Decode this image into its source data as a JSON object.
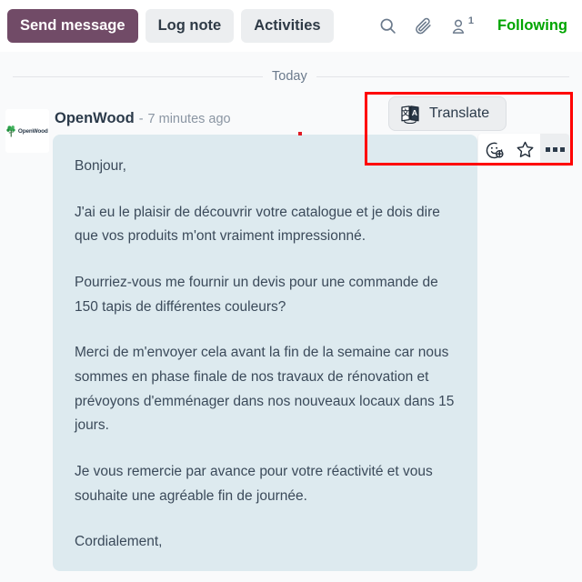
{
  "toolbar": {
    "send_message_label": "Send message",
    "log_note_label": "Log note",
    "activities_label": "Activities",
    "search_icon": "search-icon",
    "attachment_icon": "paperclip-icon",
    "followers_icon": "person-icon",
    "followers_count": "1",
    "following_label": "Following",
    "primary_color": "#714B67",
    "following_color": "#00A500"
  },
  "thread": {
    "date_divider_label": "Today",
    "message": {
      "author": "OpenWood",
      "timestamp_separator": "-",
      "timestamp": "7 minutes ago",
      "avatar_wordmark": "OpenWood",
      "avatar_icon": "tree-logo-icon",
      "bubble_color": "#DDEAEF",
      "paragraphs": [
        "Bonjour,",
        "J'ai eu le plaisir de découvrir votre catalogue et je dois dire que vos produits m'ont vraiment impressionné.",
        "Pourriez-vous me fournir un devis pour une commande de 150 tapis de différentes couleurs?",
        "Merci de m'envoyer cela avant la fin de la semaine car nous sommes en phase finale de nos travaux de rénovation et prévoyons d'emménager dans nos nouveaux locaux dans 15 jours.",
        "Je vous remercie par avance pour votre réactivité et vous souhaite une agréable fin de journée.",
        "Cordialement,"
      ]
    }
  },
  "popup": {
    "translate_label": "Translate",
    "translate_icon": "translate-icon"
  },
  "message_actions": {
    "add_reaction_icon": "add-reaction-icon",
    "mark_todo_icon": "star-icon",
    "more_icon": "ellipsis-icon"
  },
  "annotation": {
    "color": "#FF0000"
  }
}
